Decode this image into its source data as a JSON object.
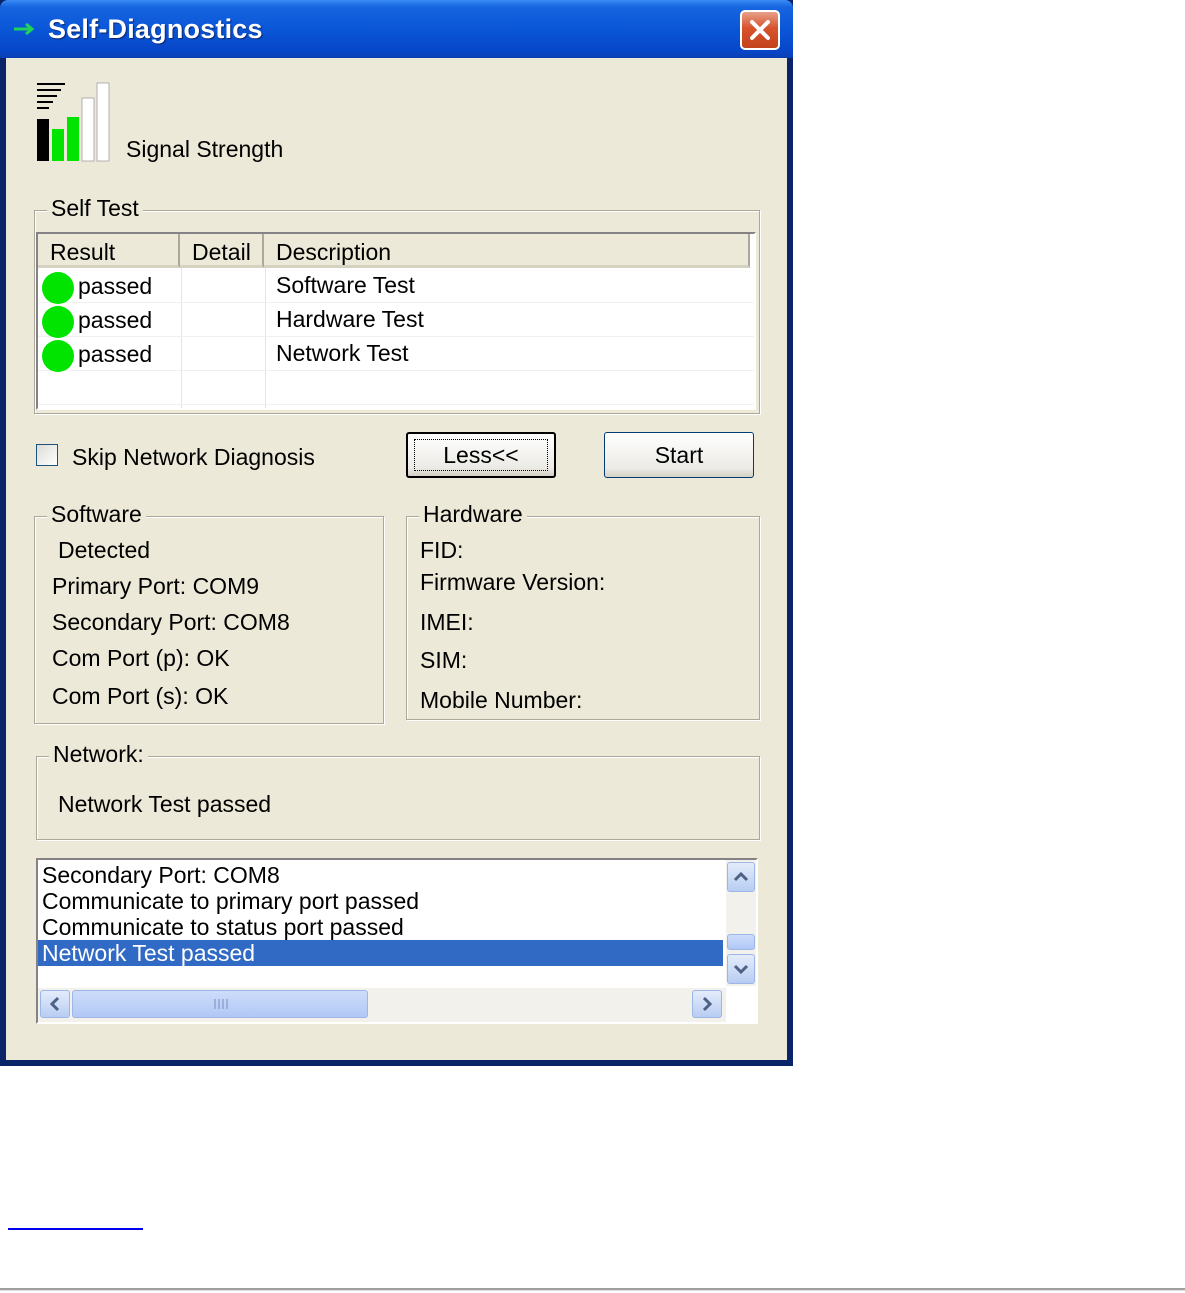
{
  "window": {
    "title": "Self-Diagnostics"
  },
  "signal": {
    "label": "Signal Strength"
  },
  "self_test": {
    "legend": "Self Test",
    "columns": [
      "Result",
      "Detail",
      "Description"
    ],
    "rows": [
      {
        "result": "passed",
        "detail": "",
        "description": "Software Test",
        "status_color": "#00e400"
      },
      {
        "result": "passed",
        "detail": "",
        "description": "Hardware Test",
        "status_color": "#00e400"
      },
      {
        "result": "passed",
        "detail": "",
        "description": "Network Test",
        "status_color": "#00e400"
      }
    ]
  },
  "controls": {
    "skip_label": "Skip Network Diagnosis",
    "skip_checked": false,
    "less_label": "Less<<",
    "start_label": "Start"
  },
  "software": {
    "legend": "Software",
    "detected": "Detected",
    "primary_port": "Primary Port: COM9",
    "secondary_port": "Secondary Port: COM8",
    "com_p": "Com Port (p): OK",
    "com_s": "Com Port (s): OK"
  },
  "hardware": {
    "legend": "Hardware",
    "fid": "FID:",
    "firmware": "Firmware Version:",
    "imei": "IMEI:",
    "sim": "SIM:",
    "mobile": "Mobile Number:"
  },
  "network": {
    "legend": "Network:",
    "status": "Network Test passed"
  },
  "log": {
    "lines": [
      "Secondary Port: COM8",
      "Communicate to primary port passed",
      "Communicate to status port passed",
      "Network Test passed"
    ],
    "selected_index": 3
  },
  "colors": {
    "title_bar": "#0a56d8",
    "dialog_bg": "#ece9d8",
    "selection": "#316ac5",
    "passed": "#00e400"
  }
}
